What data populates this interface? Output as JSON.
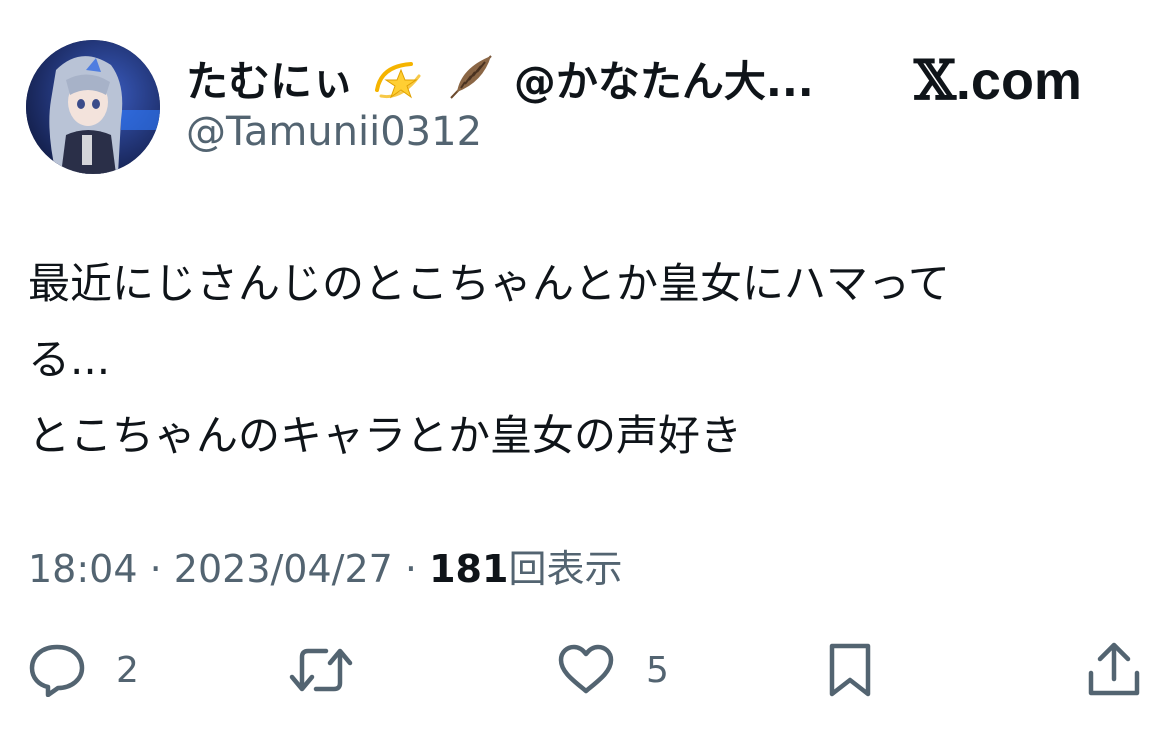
{
  "user": {
    "display_name": "たむにぃ",
    "emojis": [
      "dizzy-star-icon",
      "feather-icon"
    ],
    "name_suffix": "@かなたん大...",
    "handle": "@Tamunii0312",
    "avatar": "anime-character-avatar"
  },
  "brand": {
    "logo_mark": "𝕏",
    "logo_text": ".com"
  },
  "tweet": {
    "text": "最近にじさんじのとこちゃんとか皇女にハマって\nる...\nとこちゃんのキャラとか皇女の声好き",
    "time": "18:04",
    "separator1": "·",
    "date": "2023/04/27",
    "separator2": "·",
    "views_count": "181",
    "views_label": "回表示"
  },
  "actions": {
    "reply_count": "2",
    "retweet_count": "",
    "like_count": "5"
  },
  "colors": {
    "text_primary": "#0f1419",
    "text_secondary": "#536471",
    "background": "#ffffff"
  }
}
